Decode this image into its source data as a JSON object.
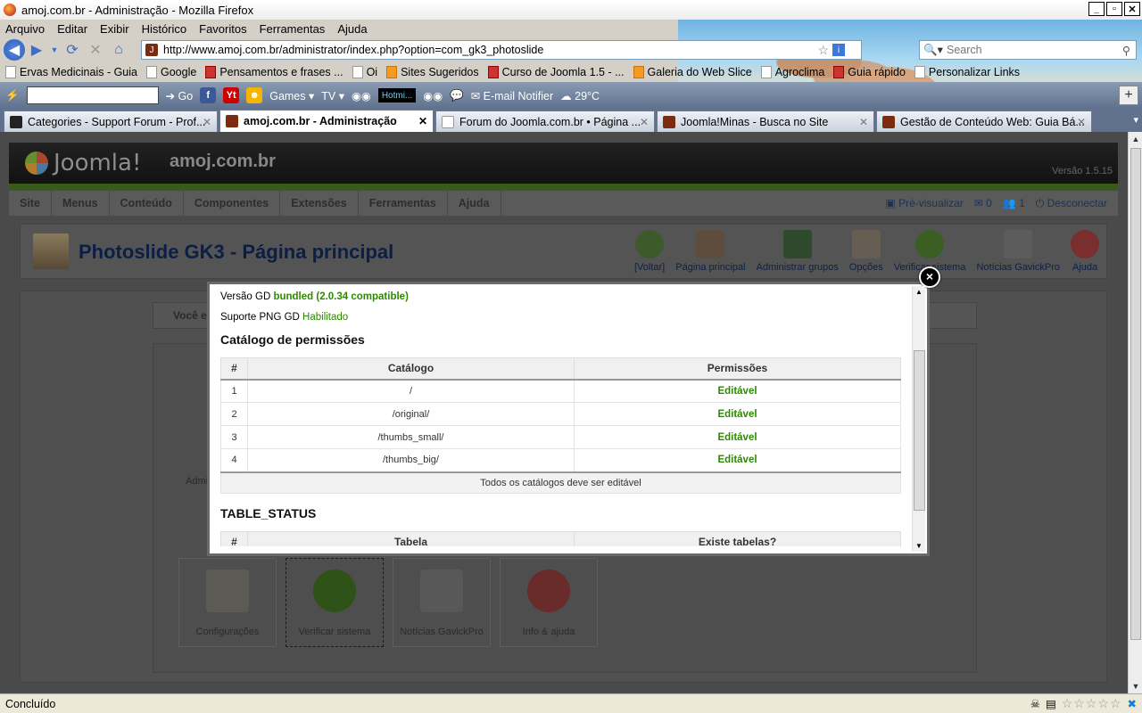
{
  "window": {
    "title": "amoj.com.br - Administração - Mozilla Firefox"
  },
  "menubar": [
    "Arquivo",
    "Editar",
    "Exibir",
    "Histórico",
    "Favoritos",
    "Ferramentas",
    "Ajuda"
  ],
  "nav": {
    "url": "http://www.amoj.com.br/administrator/index.php?option=com_gk3_photoslide",
    "search_placeholder": "Search"
  },
  "bookmarks": [
    "Ervas Medicinais - Guia",
    "Google",
    "Pensamentos e frases ...",
    "Oi",
    "Sites Sugeridos",
    "Curso de Joomla 1.5 - ...",
    "Galeria do Web Slice",
    "Agroclima",
    "Guia rápido",
    "Personalizar Links"
  ],
  "toolbar2": {
    "go": "Go",
    "games": "Games",
    "tv": "TV",
    "hotmail": "Hotmi...",
    "email": "E-mail Notifier",
    "temp": "29°C"
  },
  "tabs": [
    {
      "label": "Categories - Support Forum - Prof...",
      "active": false
    },
    {
      "label": "amoj.com.br - Administração",
      "active": true
    },
    {
      "label": "Forum do Joomla.com.br • Página ...",
      "active": false
    },
    {
      "label": "Joomla!Minas - Busca no Site",
      "active": false
    },
    {
      "label": "Gestão de Conteúdo Web: Guia Bá...",
      "active": false
    }
  ],
  "joomla": {
    "logo": "Joomla!",
    "site": "amoj.com.br",
    "version": "Versão 1.5.15",
    "menu": [
      "Site",
      "Menus",
      "Conteúdo",
      "Componentes",
      "Extensões",
      "Ferramentas",
      "Ajuda"
    ],
    "right": {
      "preview": "Pré-visualizar",
      "msgs": "0",
      "users": "1",
      "logout": "Desconectar"
    },
    "page_title": "Photoslide GK3 - Página principal",
    "tools": [
      "[Voltar]",
      "Página principal",
      "Administrar grupos",
      "Opções",
      "Verificar sistema",
      "Notícias GavickPro",
      "Ajuda"
    ],
    "message": "Você e",
    "side_admin": "Admi",
    "big_icons": [
      "Configurações",
      "Verificar sistema",
      "Notícias GavickPro",
      "Info & ajuda"
    ]
  },
  "modal": {
    "gd_label": "Versão GD",
    "gd_value": "bundled (2.0.34 compatible)",
    "png_label": "Suporte PNG GD",
    "png_value": "Habilitado",
    "perm_title": "Catálogo de permissões",
    "perm_headers": [
      "#",
      "Catálogo",
      "Permissões"
    ],
    "perm_rows": [
      {
        "n": "1",
        "dir": "/",
        "perm": "Editável"
      },
      {
        "n": "2",
        "dir": "/original/",
        "perm": "Editável"
      },
      {
        "n": "3",
        "dir": "/thumbs_small/",
        "perm": "Editável"
      },
      {
        "n": "4",
        "dir": "/thumbs_big/",
        "perm": "Editável"
      }
    ],
    "perm_footer": "Todos os catálogos deve ser editável",
    "table_title": "TABLE_STATUS",
    "table_headers": [
      "#",
      "Tabela",
      "Existe tabelas?"
    ],
    "close": "×"
  },
  "status": {
    "text": "Concluído"
  }
}
